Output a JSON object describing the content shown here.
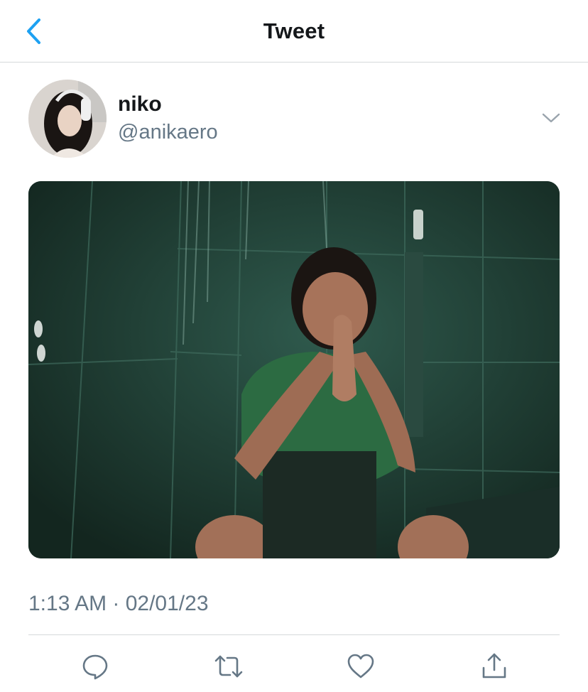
{
  "header": {
    "title": "Tweet",
    "back_icon": "chevron-left-icon",
    "accent_color": "#1da1f2"
  },
  "tweet": {
    "author": {
      "display_name": "niko",
      "handle": "@anikaero"
    },
    "media": {
      "type": "image"
    },
    "timestamp": "1:13 AM · 02/01/23"
  },
  "actions": [
    {
      "icon": "reply-icon"
    },
    {
      "icon": "retweet-icon"
    },
    {
      "icon": "like-icon"
    },
    {
      "icon": "share-icon"
    }
  ],
  "colors": {
    "text_primary": "#14171a",
    "text_secondary": "#657786",
    "divider": "#d6d9db"
  }
}
